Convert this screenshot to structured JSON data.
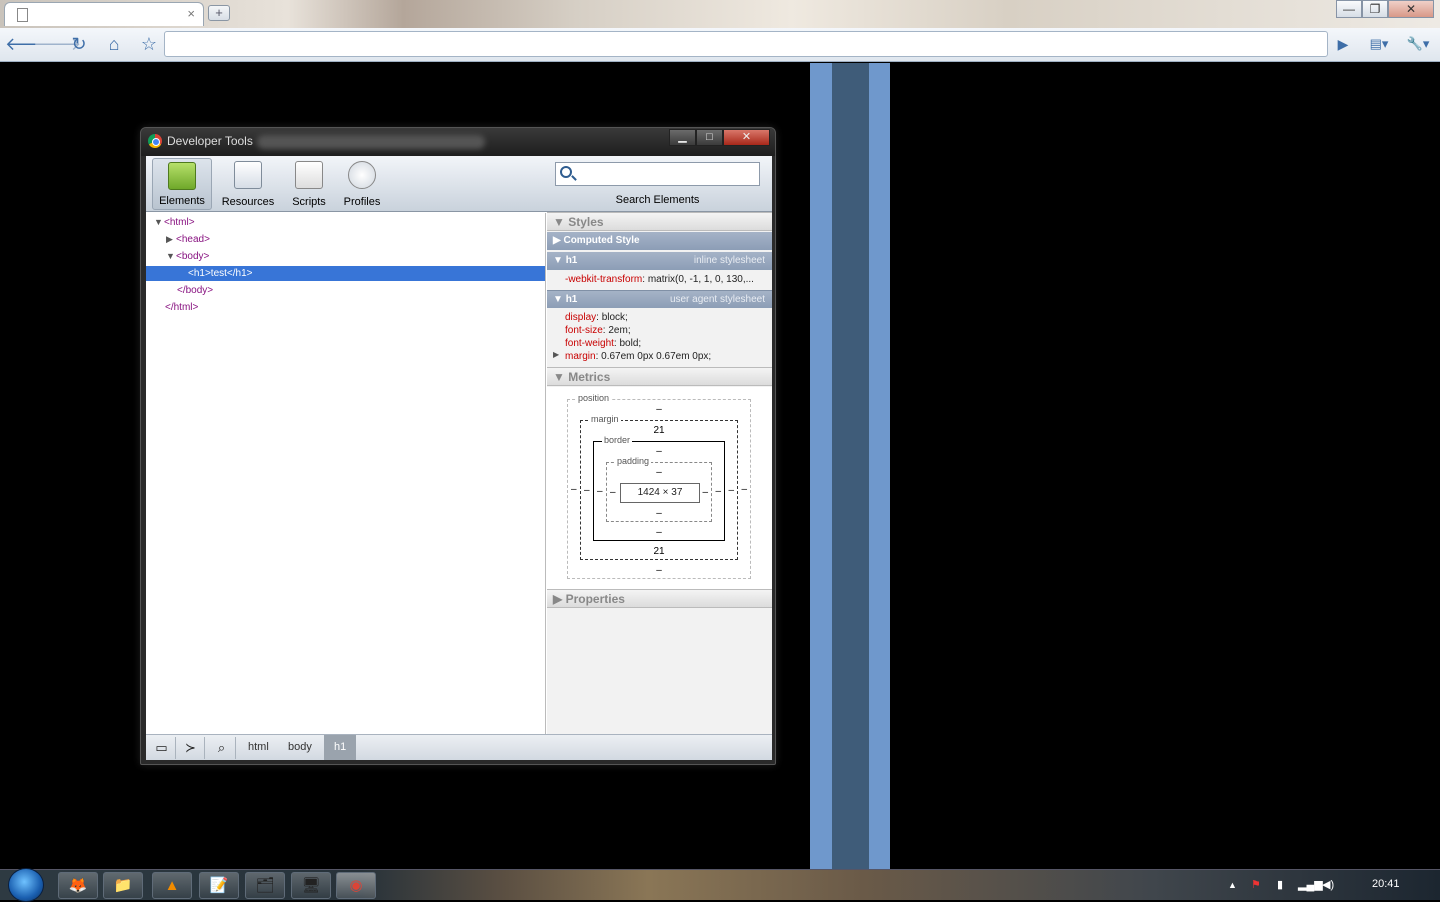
{
  "browser": {
    "tab": {
      "title": "",
      "close_glyph": "×"
    },
    "new_tab_glyph": "+",
    "window_controls": {
      "minimize": "—",
      "restore": "❐",
      "close": "✕"
    },
    "toolbar": {
      "back_glyph": "🡐",
      "forward_glyph": "🡒",
      "reload_glyph": "↻",
      "home_glyph": "⌂",
      "star_glyph": "☆",
      "omnibox_value": "",
      "play_glyph": "▶",
      "page_menu_glyph": "▤▾",
      "wrench_glyph": "🔧▾"
    }
  },
  "page": {
    "background_color": "#000000",
    "stripes": [
      {
        "color": "#6f98cc"
      },
      {
        "color": "#3f5c79"
      },
      {
        "color": "#6f98cc"
      }
    ]
  },
  "devtools": {
    "window_title": "Developer Tools",
    "window_controls": {
      "minimize": "▁",
      "maximize": "□",
      "close": "✕"
    },
    "tools": [
      {
        "label": "Elements",
        "icon": "elements-icon",
        "active": true
      },
      {
        "label": "Resources",
        "icon": "resources-icon",
        "active": false
      },
      {
        "label": "Scripts",
        "icon": "scripts-icon",
        "active": false
      },
      {
        "label": "Profiles",
        "icon": "profiles-icon",
        "active": false
      }
    ],
    "search": {
      "placeholder": "",
      "value": "",
      "label": "Search Elements"
    },
    "dom_tree": [
      {
        "text": "<html>",
        "triangle": "▼",
        "selected": false
      },
      {
        "text": "<head>",
        "triangle": "▶",
        "selected": false
      },
      {
        "text": "<body>",
        "triangle": "▼",
        "selected": false
      },
      {
        "text": "<h1>test</h1>",
        "triangle": "",
        "selected": true
      },
      {
        "text": "</body>",
        "triangle": "",
        "selected": false
      },
      {
        "text": "</html>",
        "triangle": "",
        "selected": false
      }
    ],
    "styles": {
      "title": "Styles",
      "computed_title": "Computed Style",
      "rules": [
        {
          "selector": "h1",
          "source": "inline stylesheet",
          "properties": [
            {
              "name": "-webkit-transform",
              "value": "matrix(0, -1, 1, 0, 130,..."
            }
          ]
        },
        {
          "selector": "h1",
          "source": "user agent stylesheet",
          "properties": [
            {
              "name": "display",
              "value": "block;"
            },
            {
              "name": "font-size",
              "value": "2em;"
            },
            {
              "name": "font-weight",
              "value": "bold;"
            },
            {
              "name": "margin",
              "value": "0.67em 0px 0.67em 0px;"
            }
          ]
        }
      ]
    },
    "metrics": {
      "title": "Metrics",
      "position_label": "position",
      "margin_label": "margin",
      "border_label": "border",
      "padding_label": "padding",
      "position": {
        "top": "–",
        "bottom": "–",
        "left": "–",
        "right": "–"
      },
      "margin": {
        "top": "21",
        "bottom": "21",
        "left": "–",
        "right": "–"
      },
      "border": {
        "top": "–",
        "bottom": "–",
        "left": "–",
        "right": "–"
      },
      "padding": {
        "top": "–",
        "bottom": "–",
        "left": "–",
        "right": "–"
      },
      "content": "1424 × 37"
    },
    "properties_title": "Properties",
    "breadcrumbs": [
      "html",
      "body",
      "h1"
    ]
  },
  "taskbar": {
    "apps": [
      {
        "icon": "firefox-icon",
        "glyph": "🦊"
      },
      {
        "icon": "explorer-icon",
        "glyph": "📁"
      },
      {
        "icon": "vlc-icon",
        "glyph": "▲"
      },
      {
        "icon": "notepad-icon",
        "glyph": "📝"
      },
      {
        "icon": "folder-icon",
        "glyph": "🗂"
      },
      {
        "icon": "control-panel-icon",
        "glyph": "🖥"
      },
      {
        "icon": "chrome-icon",
        "glyph": "◉"
      }
    ],
    "tray": {
      "show_hidden_glyph": "▲",
      "clock": "20:41"
    }
  }
}
